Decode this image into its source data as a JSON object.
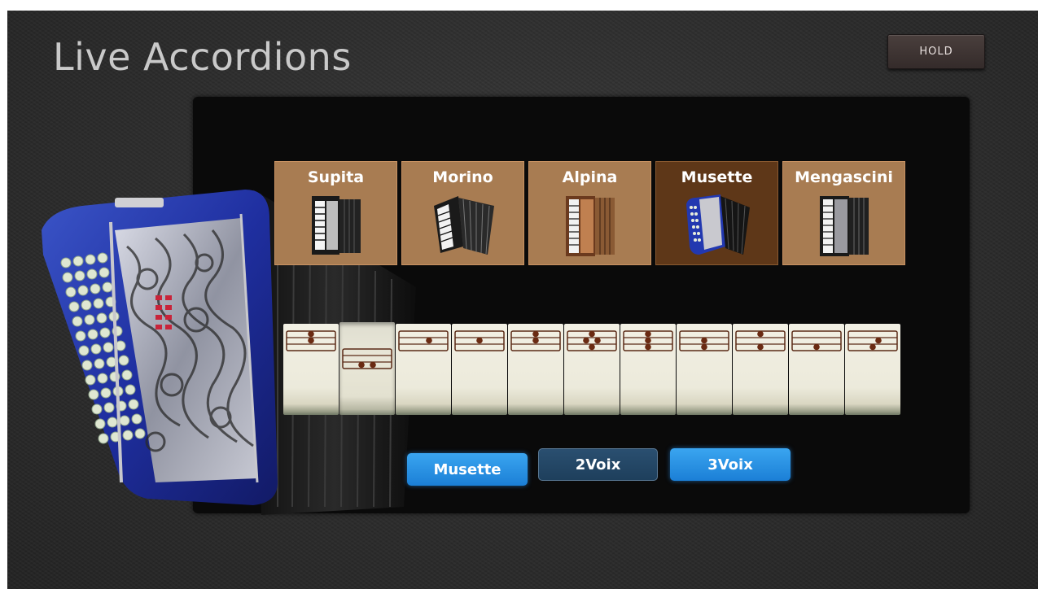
{
  "app": {
    "title": "Live Accordions"
  },
  "hold_button": {
    "label": "HOLD"
  },
  "presets": [
    {
      "label": "Supita",
      "selected": false
    },
    {
      "label": "Morino",
      "selected": false
    },
    {
      "label": "Alpina",
      "selected": false
    },
    {
      "label": "Musette",
      "selected": true
    },
    {
      "label": "Mengascini",
      "selected": false
    }
  ],
  "registers": [
    {
      "dots": [
        "top",
        "mid"
      ],
      "pressed": false
    },
    {
      "dots": [
        "bottom-left",
        "bottom-right"
      ],
      "pressed": true
    },
    {
      "dots": [
        "mid-right"
      ],
      "pressed": false
    },
    {
      "dots": [
        "mid"
      ],
      "pressed": false
    },
    {
      "dots": [
        "top",
        "mid"
      ],
      "pressed": false
    },
    {
      "dots": [
        "top",
        "mid-left",
        "mid-right",
        "bottom"
      ],
      "pressed": false
    },
    {
      "dots": [
        "top",
        "mid",
        "bottom"
      ],
      "pressed": false
    },
    {
      "dots": [
        "mid",
        "bottom"
      ],
      "pressed": false
    },
    {
      "dots": [
        "top",
        "bottom"
      ],
      "pressed": false
    },
    {
      "dots": [
        "bottom"
      ],
      "pressed": false
    },
    {
      "dots": [
        "mid-right",
        "bottom"
      ],
      "pressed": false
    }
  ],
  "voice_buttons": [
    {
      "label": "Musette",
      "state": "on"
    },
    {
      "label": "2Voix",
      "state": "off"
    },
    {
      "label": "3Voix",
      "state": "on"
    }
  ],
  "colors": {
    "preset_bg": "#a87c52",
    "preset_selected_bg": "#5e3718",
    "accent_blue": "#1b7fd6",
    "dot": "#6a2a12"
  }
}
